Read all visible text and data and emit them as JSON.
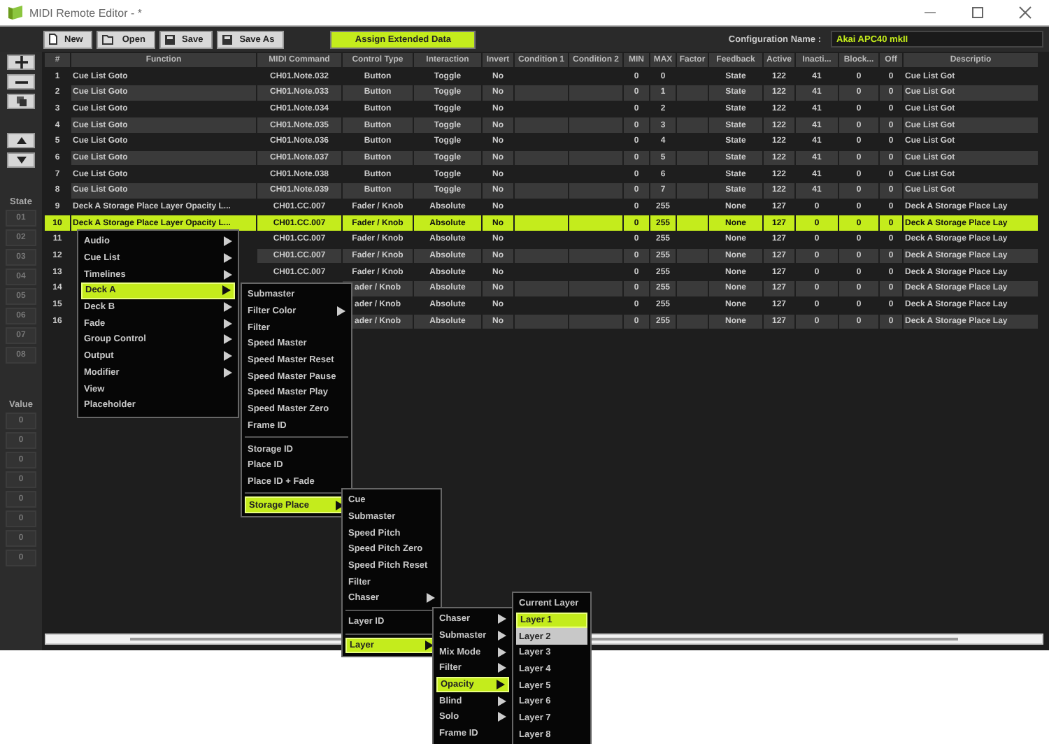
{
  "window": {
    "title": "MIDI Remote Editor - *"
  },
  "toolbar": {
    "buttons": [
      {
        "kind": "new",
        "label": "New"
      },
      {
        "kind": "open",
        "label": "Open"
      },
      {
        "kind": "save",
        "label": "Save"
      },
      {
        "kind": "save",
        "label": "Save As"
      }
    ],
    "assign_button": "Assign Extended Data",
    "config_label": "Configuration Name :",
    "config_value": "Akai APC40 mkII"
  },
  "sidebar": {
    "tools": [
      {
        "kind": "plus"
      },
      {
        "kind": "minus"
      },
      {
        "kind": "copy"
      }
    ],
    "moves": [
      {
        "kind": "up"
      },
      {
        "kind": "down"
      }
    ],
    "state_label": "State",
    "states": [
      "01",
      "02",
      "03",
      "04",
      "05",
      "06",
      "07",
      "08"
    ],
    "value_label": "Value",
    "values": [
      "0",
      "0",
      "0",
      "0",
      "0",
      "0",
      "0",
      "0"
    ]
  },
  "table": {
    "columns": [
      "#",
      "Function",
      "MIDI Command",
      "Control Type",
      "Interaction",
      "Invert",
      "Condition 1",
      "Condition 2",
      "MIN",
      "MAX",
      "Factor",
      "Feedback",
      "Active",
      "Inacti...",
      "Block...",
      "Off",
      "Descriptio"
    ],
    "rows": [
      {
        "selected": false,
        "cells": [
          "1",
          "Cue List Goto",
          "CH01.Note.032",
          "Button",
          "Toggle",
          "No",
          null,
          null,
          "0",
          "0",
          null,
          "State",
          "122",
          "41",
          "0",
          "0",
          "Cue List Got"
        ]
      },
      {
        "selected": false,
        "cells": [
          "2",
          "Cue List Goto",
          "CH01.Note.033",
          "Button",
          "Toggle",
          "No",
          null,
          null,
          "0",
          "1",
          null,
          "State",
          "122",
          "41",
          "0",
          "0",
          "Cue List Got"
        ]
      },
      {
        "selected": false,
        "cells": [
          "3",
          "Cue List Goto",
          "CH01.Note.034",
          "Button",
          "Toggle",
          "No",
          null,
          null,
          "0",
          "2",
          null,
          "State",
          "122",
          "41",
          "0",
          "0",
          "Cue List Got"
        ]
      },
      {
        "selected": false,
        "cells": [
          "4",
          "Cue List Goto",
          "CH01.Note.035",
          "Button",
          "Toggle",
          "No",
          null,
          null,
          "0",
          "3",
          null,
          "State",
          "122",
          "41",
          "0",
          "0",
          "Cue List Got"
        ]
      },
      {
        "selected": false,
        "cells": [
          "5",
          "Cue List Goto",
          "CH01.Note.036",
          "Button",
          "Toggle",
          "No",
          null,
          null,
          "0",
          "4",
          null,
          "State",
          "122",
          "41",
          "0",
          "0",
          "Cue List Got"
        ]
      },
      {
        "selected": false,
        "cells": [
          "6",
          "Cue List Goto",
          "CH01.Note.037",
          "Button",
          "Toggle",
          "No",
          null,
          null,
          "0",
          "5",
          null,
          "State",
          "122",
          "41",
          "0",
          "0",
          "Cue List Got"
        ]
      },
      {
        "selected": false,
        "cells": [
          "7",
          "Cue List Goto",
          "CH01.Note.038",
          "Button",
          "Toggle",
          "No",
          null,
          null,
          "0",
          "6",
          null,
          "State",
          "122",
          "41",
          "0",
          "0",
          "Cue List Got"
        ]
      },
      {
        "selected": false,
        "cells": [
          "8",
          "Cue List Goto",
          "CH01.Note.039",
          "Button",
          "Toggle",
          "No",
          null,
          null,
          "0",
          "7",
          null,
          "State",
          "122",
          "41",
          "0",
          "0",
          "Cue List Got"
        ]
      },
      {
        "selected": false,
        "cells": [
          "9",
          "Deck A Storage Place Layer Opacity L...",
          "CH01.CC.007",
          "Fader / Knob",
          "Absolute",
          "No",
          null,
          null,
          "0",
          "255",
          null,
          "None",
          "127",
          "0",
          "0",
          "0",
          "Deck A Storage Place Lay"
        ]
      },
      {
        "selected": true,
        "cells": [
          "10",
          "Deck A Storage Place Layer Opacity L...",
          "CH01.CC.007",
          "Fader / Knob",
          "Absolute",
          "No",
          null,
          null,
          "0",
          "255",
          null,
          "None",
          "127",
          "0",
          "0",
          "0",
          "Deck A Storage Place Lay"
        ]
      },
      {
        "selected": false,
        "cells": [
          "11",
          null,
          "CH01.CC.007",
          "Fader / Knob",
          "Absolute",
          "No",
          null,
          null,
          "0",
          "255",
          null,
          "None",
          "127",
          "0",
          "0",
          "0",
          "Deck A Storage Place Lay"
        ]
      },
      {
        "selected": false,
        "cells": [
          "12",
          null,
          "CH01.CC.007",
          "Fader / Knob",
          "Absolute",
          "No",
          null,
          null,
          "0",
          "255",
          null,
          "None",
          "127",
          "0",
          "0",
          "0",
          "Deck A Storage Place Lay"
        ]
      },
      {
        "selected": false,
        "cells": [
          "13",
          null,
          "CH01.CC.007",
          "Fader / Knob",
          "Absolute",
          "No",
          null,
          null,
          "0",
          "255",
          null,
          "None",
          "127",
          "0",
          "0",
          "0",
          "Deck A Storage Place Lay"
        ]
      },
      {
        "selected": false,
        "cells": [
          "14",
          null,
          null,
          "ader / Knob",
          "Absolute",
          "No",
          null,
          null,
          "0",
          "255",
          null,
          "None",
          "127",
          "0",
          "0",
          "0",
          "Deck A Storage Place Lay"
        ]
      },
      {
        "selected": false,
        "cells": [
          "15",
          null,
          null,
          "ader / Knob",
          "Absolute",
          "No",
          null,
          null,
          "0",
          "255",
          null,
          "None",
          "127",
          "0",
          "0",
          "0",
          "Deck A Storage Place Lay"
        ]
      },
      {
        "selected": false,
        "cells": [
          "16",
          null,
          null,
          "ader / Knob",
          "Absolute",
          "No",
          null,
          null,
          "0",
          "255",
          null,
          "None",
          "127",
          "0",
          "0",
          "0",
          "Deck A Storage Place Lay"
        ]
      }
    ]
  },
  "menus": [
    {
      "items": [
        {
          "kind": "item",
          "label": "Audio",
          "submenu": true,
          "selected": false,
          "hovered": false
        },
        {
          "kind": "item",
          "label": "Cue List",
          "submenu": true,
          "selected": false,
          "hovered": false
        },
        {
          "kind": "item",
          "label": "Timelines",
          "submenu": true,
          "selected": false,
          "hovered": false
        },
        {
          "kind": "item",
          "label": "Deck A",
          "submenu": true,
          "selected": true,
          "hovered": false
        },
        {
          "kind": "item",
          "label": "Deck B",
          "submenu": true,
          "selected": false,
          "hovered": false
        },
        {
          "kind": "item",
          "label": "Fade",
          "submenu": true,
          "selected": false,
          "hovered": false
        },
        {
          "kind": "item",
          "label": "Group Control",
          "submenu": true,
          "selected": false,
          "hovered": false
        },
        {
          "kind": "item",
          "label": "Output",
          "submenu": true,
          "selected": false,
          "hovered": false
        },
        {
          "kind": "item",
          "label": "Modifier",
          "submenu": true,
          "selected": false,
          "hovered": false
        },
        {
          "kind": "item",
          "label": "View",
          "submenu": false,
          "selected": false,
          "hovered": false
        },
        {
          "kind": "item",
          "label": "Placeholder",
          "submenu": false,
          "selected": false,
          "hovered": false
        }
      ]
    },
    {
      "items": [
        {
          "kind": "item",
          "label": "Submaster",
          "submenu": false,
          "selected": false,
          "hovered": false
        },
        {
          "kind": "item",
          "label": "Filter Color",
          "submenu": true,
          "selected": false,
          "hovered": false
        },
        {
          "kind": "item",
          "label": "Filter",
          "submenu": false,
          "selected": false,
          "hovered": false
        },
        {
          "kind": "item",
          "label": "Speed Master",
          "submenu": false,
          "selected": false,
          "hovered": false
        },
        {
          "kind": "item",
          "label": "Speed Master Reset",
          "submenu": false,
          "selected": false,
          "hovered": false
        },
        {
          "kind": "item",
          "label": "Speed Master Pause",
          "submenu": false,
          "selected": false,
          "hovered": false
        },
        {
          "kind": "item",
          "label": "Speed Master Play",
          "submenu": false,
          "selected": false,
          "hovered": false
        },
        {
          "kind": "item",
          "label": "Speed Master Zero",
          "submenu": false,
          "selected": false,
          "hovered": false
        },
        {
          "kind": "item",
          "label": "Frame ID",
          "submenu": false,
          "selected": false,
          "hovered": false
        },
        {
          "kind": "separator"
        },
        {
          "kind": "item",
          "label": "Storage ID",
          "submenu": false,
          "selected": false,
          "hovered": false
        },
        {
          "kind": "item",
          "label": "Place ID",
          "submenu": false,
          "selected": false,
          "hovered": false
        },
        {
          "kind": "item",
          "label": "Place ID + Fade",
          "submenu": false,
          "selected": false,
          "hovered": false
        },
        {
          "kind": "separator"
        },
        {
          "kind": "item",
          "label": "Storage Place",
          "submenu": true,
          "selected": true,
          "hovered": false
        }
      ]
    },
    {
      "items": [
        {
          "kind": "item",
          "label": "Cue",
          "submenu": false,
          "selected": false,
          "hovered": false
        },
        {
          "kind": "item",
          "label": "Submaster",
          "submenu": false,
          "selected": false,
          "hovered": false
        },
        {
          "kind": "item",
          "label": "Speed Pitch",
          "submenu": false,
          "selected": false,
          "hovered": false
        },
        {
          "kind": "item",
          "label": "Speed Pitch Zero",
          "submenu": false,
          "selected": false,
          "hovered": false
        },
        {
          "kind": "item",
          "label": "Speed Pitch Reset",
          "submenu": false,
          "selected": false,
          "hovered": false
        },
        {
          "kind": "item",
          "label": "Filter",
          "submenu": false,
          "selected": false,
          "hovered": false
        },
        {
          "kind": "item",
          "label": "Chaser",
          "submenu": true,
          "selected": false,
          "hovered": false
        },
        {
          "kind": "separator"
        },
        {
          "kind": "item",
          "label": "Layer ID",
          "submenu": false,
          "selected": false,
          "hovered": false
        },
        {
          "kind": "separator"
        },
        {
          "kind": "item",
          "label": "Layer",
          "submenu": true,
          "selected": true,
          "hovered": false
        }
      ]
    },
    {
      "items": [
        {
          "kind": "item",
          "label": "Chaser",
          "submenu": true,
          "selected": false,
          "hovered": false
        },
        {
          "kind": "item",
          "label": "Submaster",
          "submenu": true,
          "selected": false,
          "hovered": false
        },
        {
          "kind": "item",
          "label": "Mix Mode",
          "submenu": true,
          "selected": false,
          "hovered": false
        },
        {
          "kind": "item",
          "label": "Filter",
          "submenu": true,
          "selected": false,
          "hovered": false
        },
        {
          "kind": "item",
          "label": "Opacity",
          "submenu": true,
          "selected": true,
          "hovered": false
        },
        {
          "kind": "item",
          "label": "Blind",
          "submenu": true,
          "selected": false,
          "hovered": false
        },
        {
          "kind": "item",
          "label": "Solo",
          "submenu": true,
          "selected": false,
          "hovered": false
        },
        {
          "kind": "item",
          "label": "Frame ID",
          "submenu": false,
          "selected": false,
          "hovered": false
        }
      ]
    },
    {
      "items": [
        {
          "kind": "item",
          "label": "Current Layer",
          "submenu": false,
          "selected": false,
          "hovered": false
        },
        {
          "kind": "item",
          "label": "Layer 1",
          "submenu": false,
          "selected": true,
          "hovered": false
        },
        {
          "kind": "item",
          "label": "Layer 2",
          "submenu": false,
          "selected": false,
          "hovered": true
        },
        {
          "kind": "item",
          "label": "Layer 3",
          "submenu": false,
          "selected": false,
          "hovered": false
        },
        {
          "kind": "item",
          "label": "Layer 4",
          "submenu": false,
          "selected": false,
          "hovered": false
        },
        {
          "kind": "item",
          "label": "Layer 5",
          "submenu": false,
          "selected": false,
          "hovered": false
        },
        {
          "kind": "item",
          "label": "Layer 6",
          "submenu": false,
          "selected": false,
          "hovered": false
        },
        {
          "kind": "item",
          "label": "Layer 7",
          "submenu": false,
          "selected": false,
          "hovered": false
        },
        {
          "kind": "item",
          "label": "Layer 8",
          "submenu": false,
          "selected": false,
          "hovered": false
        }
      ]
    }
  ]
}
